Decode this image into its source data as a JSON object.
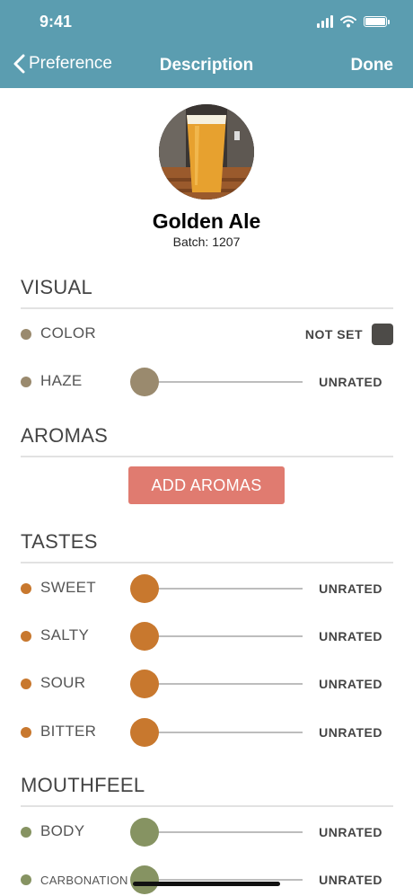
{
  "status_bar": {
    "time": "9:41"
  },
  "nav": {
    "back_label": "Preference",
    "title": "Description",
    "done_label": "Done"
  },
  "beer": {
    "name": "Golden Ale",
    "batch": "Batch: 1207"
  },
  "sections": {
    "visual": {
      "title": "VISUAL",
      "color_row": {
        "label": "COLOR",
        "status": "NOT SET",
        "dot_color": "#9a8a6e",
        "swatch_color": "#4d4b48"
      },
      "haze_row": {
        "label": "HAZE",
        "status": "UNRATED",
        "dot_color": "#9a8a6e"
      }
    },
    "aromas": {
      "title": "AROMAS",
      "button_label": "ADD AROMAS",
      "button_color": "#e07b70"
    },
    "tastes": {
      "title": "TASTES",
      "accent": "#c8782e",
      "rows": [
        {
          "label": "SWEET",
          "status": "UNRATED"
        },
        {
          "label": "SALTY",
          "status": "UNRATED"
        },
        {
          "label": "SOUR",
          "status": "UNRATED"
        },
        {
          "label": "BITTER",
          "status": "UNRATED"
        }
      ]
    },
    "mouthfeel": {
      "title": "MOUTHFEEL",
      "accent": "#869362",
      "rows": [
        {
          "label": "BODY",
          "status": "UNRATED"
        },
        {
          "label": "CARBONATION",
          "status": "UNRATED"
        }
      ]
    }
  },
  "colors": {
    "header": "#5b9db0"
  },
  "icons": [
    "back-chevron-icon",
    "signal-icon",
    "wifi-icon",
    "battery-icon"
  ]
}
